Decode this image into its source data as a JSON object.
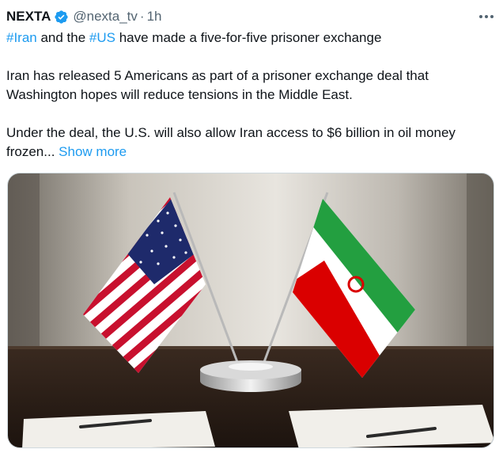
{
  "author": {
    "name": "NEXTA",
    "handle": "@nexta_tv",
    "separator": "·",
    "time": "1h",
    "verified": true
  },
  "icons": {
    "verified": "verified-badge-icon",
    "more": "more-horizontal-icon"
  },
  "tweet": {
    "line1": {
      "tag1": "#Iran",
      "mid": " and the ",
      "tag2": "#US",
      "rest": " have made a five-for-five prisoner exchange"
    },
    "paragraph2": "Iran has released 5 Americans as part of a prisoner exchange deal that Washington hopes will reduce tensions in the Middle East.",
    "paragraph3": "Under the deal, the U.S. will also allow Iran access to $6 billion in oil money frozen...",
    "show_more": "Show more"
  },
  "media": {
    "description_icon": "us-iran-desk-flags-photo"
  },
  "colors": {
    "link": "#1d9bf0",
    "secondary_text": "#536471",
    "verified_badge": "#1d9bf0"
  }
}
